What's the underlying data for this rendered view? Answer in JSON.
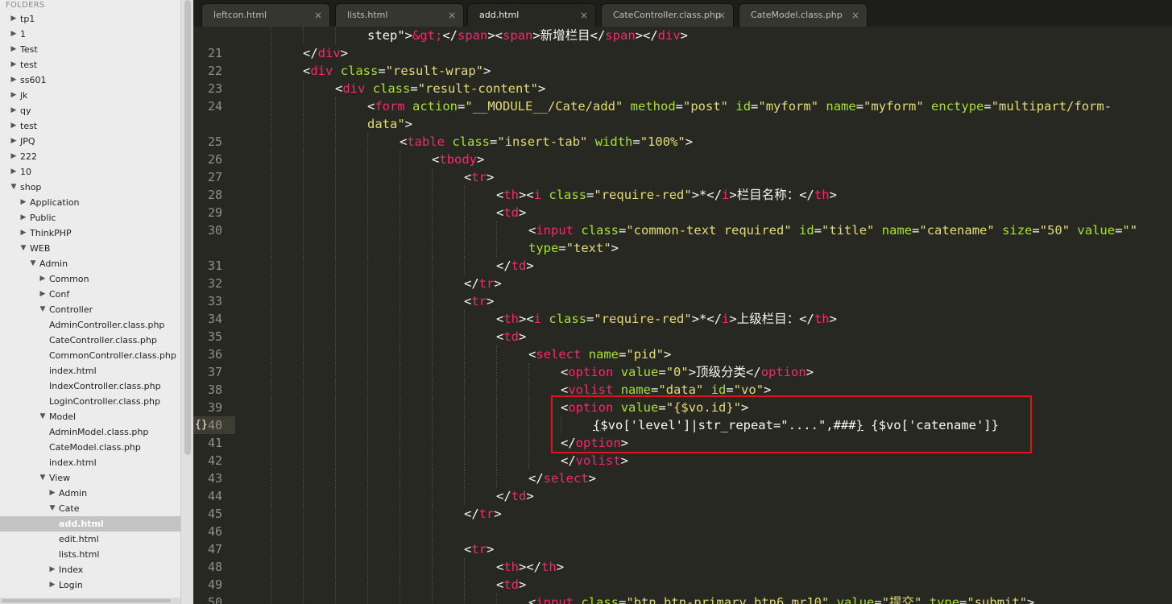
{
  "sidebar": {
    "header": "FOLDERS",
    "items": [
      {
        "label": "tp1",
        "depth": 0,
        "expanded": false
      },
      {
        "label": "1",
        "depth": 0,
        "expanded": false
      },
      {
        "label": "Test",
        "depth": 0,
        "expanded": false
      },
      {
        "label": "test",
        "depth": 0,
        "expanded": false
      },
      {
        "label": "ss601",
        "depth": 0,
        "expanded": false
      },
      {
        "label": "jk",
        "depth": 0,
        "expanded": false
      },
      {
        "label": "qy",
        "depth": 0,
        "expanded": false
      },
      {
        "label": "test",
        "depth": 0,
        "expanded": false
      },
      {
        "label": "JPQ",
        "depth": 0,
        "expanded": false
      },
      {
        "label": "222",
        "depth": 0,
        "expanded": false
      },
      {
        "label": "10",
        "depth": 0,
        "expanded": false
      },
      {
        "label": "shop",
        "depth": 0,
        "expanded": true
      },
      {
        "label": "Application",
        "depth": 1,
        "expanded": false
      },
      {
        "label": "Public",
        "depth": 1,
        "expanded": false
      },
      {
        "label": "ThinkPHP",
        "depth": 1,
        "expanded": false
      },
      {
        "label": "WEB",
        "depth": 1,
        "expanded": true
      },
      {
        "label": "Admin",
        "depth": 2,
        "expanded": true
      },
      {
        "label": "Common",
        "depth": 3,
        "expanded": false
      },
      {
        "label": "Conf",
        "depth": 3,
        "expanded": false
      },
      {
        "label": "Controller",
        "depth": 3,
        "expanded": true
      },
      {
        "label": "AdminController.class.php",
        "depth": 4,
        "file": true
      },
      {
        "label": "CateController.class.php",
        "depth": 4,
        "file": true
      },
      {
        "label": "CommonController.class.php",
        "depth": 4,
        "file": true
      },
      {
        "label": "index.html",
        "depth": 4,
        "file": true
      },
      {
        "label": "IndexController.class.php",
        "depth": 4,
        "file": true
      },
      {
        "label": "LoginController.class.php",
        "depth": 4,
        "file": true
      },
      {
        "label": "Model",
        "depth": 3,
        "expanded": true
      },
      {
        "label": "AdminModel.class.php",
        "depth": 4,
        "file": true
      },
      {
        "label": "CateModel.class.php",
        "depth": 4,
        "file": true
      },
      {
        "label": "index.html",
        "depth": 4,
        "file": true
      },
      {
        "label": "View",
        "depth": 3,
        "expanded": true
      },
      {
        "label": "Admin",
        "depth": 4,
        "expanded": false
      },
      {
        "label": "Cate",
        "depth": 4,
        "expanded": true
      },
      {
        "label": "add.html",
        "depth": 5,
        "file": true,
        "selected": true
      },
      {
        "label": "edit.html",
        "depth": 5,
        "file": true
      },
      {
        "label": "lists.html",
        "depth": 5,
        "file": true
      },
      {
        "label": "Index",
        "depth": 4,
        "expanded": false
      },
      {
        "label": "Login",
        "depth": 4,
        "expanded": false
      }
    ]
  },
  "tabs": [
    {
      "label": "leftcon.html",
      "active": false
    },
    {
      "label": "lists.html",
      "active": false
    },
    {
      "label": "add.html",
      "active": true
    },
    {
      "label": "CateController.class.php",
      "active": false
    },
    {
      "label": "CateModel.class.php",
      "active": false
    }
  ],
  "close_glyph": "×",
  "fold_glyph": "{}",
  "lines": [
    {
      "num": "",
      "indent": 4,
      "segs": [
        [
          "p",
          "step\">"
        ],
        [
          "t",
          "&gt;"
        ],
        [
          "p",
          "</"
        ],
        [
          "t",
          "span"
        ],
        [
          "p",
          "><"
        ],
        [
          "t",
          "span"
        ],
        [
          "p",
          ">新增栏目</"
        ],
        [
          "t",
          "span"
        ],
        [
          "p",
          "></"
        ],
        [
          "t",
          "div"
        ],
        [
          "p",
          ">"
        ]
      ]
    },
    {
      "num": "21",
      "indent": 2,
      "segs": [
        [
          "p",
          "</"
        ],
        [
          "t",
          "div"
        ],
        [
          "p",
          ">"
        ]
      ]
    },
    {
      "num": "22",
      "indent": 2,
      "segs": [
        [
          "p",
          "<"
        ],
        [
          "t",
          "div"
        ],
        [
          "p",
          " "
        ],
        [
          "a",
          "class"
        ],
        [
          "p",
          "="
        ],
        [
          "s",
          "\"result-wrap\""
        ],
        [
          "p",
          ">"
        ]
      ]
    },
    {
      "num": "23",
      "indent": 3,
      "segs": [
        [
          "p",
          "<"
        ],
        [
          "t",
          "div"
        ],
        [
          "p",
          " "
        ],
        [
          "a",
          "class"
        ],
        [
          "p",
          "="
        ],
        [
          "s",
          "\"result-content\""
        ],
        [
          "p",
          ">"
        ]
      ]
    },
    {
      "num": "24",
      "indent": 4,
      "segs": [
        [
          "p",
          "<"
        ],
        [
          "t",
          "form"
        ],
        [
          "p",
          " "
        ],
        [
          "a",
          "action"
        ],
        [
          "p",
          "="
        ],
        [
          "s",
          "\"__MODULE__/Cate/add\""
        ],
        [
          "p",
          " "
        ],
        [
          "a",
          "method"
        ],
        [
          "p",
          "="
        ],
        [
          "s",
          "\"post\""
        ],
        [
          "p",
          " "
        ],
        [
          "a",
          "id"
        ],
        [
          "p",
          "="
        ],
        [
          "s",
          "\"myform\""
        ],
        [
          "p",
          " "
        ],
        [
          "a",
          "name"
        ],
        [
          "p",
          "="
        ],
        [
          "s",
          "\"myform\""
        ],
        [
          "p",
          " "
        ],
        [
          "a",
          "enctype"
        ],
        [
          "p",
          "="
        ],
        [
          "s",
          "\"multipart/form-"
        ]
      ]
    },
    {
      "num": "",
      "indent": 4,
      "segs": [
        [
          "s",
          "data\""
        ],
        [
          "p",
          ">"
        ]
      ]
    },
    {
      "num": "25",
      "indent": 5,
      "segs": [
        [
          "p",
          "<"
        ],
        [
          "t",
          "table"
        ],
        [
          "p",
          " "
        ],
        [
          "a",
          "class"
        ],
        [
          "p",
          "="
        ],
        [
          "s",
          "\"insert-tab\""
        ],
        [
          "p",
          " "
        ],
        [
          "a",
          "width"
        ],
        [
          "p",
          "="
        ],
        [
          "s",
          "\"100%\""
        ],
        [
          "p",
          ">"
        ]
      ]
    },
    {
      "num": "26",
      "indent": 6,
      "segs": [
        [
          "p",
          "<"
        ],
        [
          "t",
          "tbody"
        ],
        [
          "p",
          ">"
        ]
      ]
    },
    {
      "num": "27",
      "indent": 7,
      "segs": [
        [
          "p",
          "<"
        ],
        [
          "t",
          "tr"
        ],
        [
          "p",
          ">"
        ]
      ]
    },
    {
      "num": "28",
      "indent": 8,
      "segs": [
        [
          "p",
          "<"
        ],
        [
          "t",
          "th"
        ],
        [
          "p",
          "><"
        ],
        [
          "t",
          "i"
        ],
        [
          "p",
          " "
        ],
        [
          "a",
          "class"
        ],
        [
          "p",
          "="
        ],
        [
          "s",
          "\"require-red\""
        ],
        [
          "p",
          ">*</"
        ],
        [
          "t",
          "i"
        ],
        [
          "p",
          ">栏目名称：</"
        ],
        [
          "t",
          "th"
        ],
        [
          "p",
          ">"
        ]
      ]
    },
    {
      "num": "29",
      "indent": 8,
      "segs": [
        [
          "p",
          "<"
        ],
        [
          "t",
          "td"
        ],
        [
          "p",
          ">"
        ]
      ]
    },
    {
      "num": "30",
      "indent": 9,
      "segs": [
        [
          "p",
          "<"
        ],
        [
          "t",
          "input"
        ],
        [
          "p",
          " "
        ],
        [
          "a",
          "class"
        ],
        [
          "p",
          "="
        ],
        [
          "s",
          "\"common-text required\""
        ],
        [
          "p",
          " "
        ],
        [
          "a",
          "id"
        ],
        [
          "p",
          "="
        ],
        [
          "s",
          "\"title\""
        ],
        [
          "p",
          " "
        ],
        [
          "a",
          "name"
        ],
        [
          "p",
          "="
        ],
        [
          "s",
          "\"catename\""
        ],
        [
          "p",
          " "
        ],
        [
          "a",
          "size"
        ],
        [
          "p",
          "="
        ],
        [
          "s",
          "\"50\""
        ],
        [
          "p",
          " "
        ],
        [
          "a",
          "value"
        ],
        [
          "p",
          "="
        ],
        [
          "s",
          "\"\""
        ]
      ]
    },
    {
      "num": "",
      "indent": 9,
      "segs": [
        [
          "a",
          "type"
        ],
        [
          "p",
          "="
        ],
        [
          "s",
          "\"text\""
        ],
        [
          "p",
          ">"
        ]
      ]
    },
    {
      "num": "31",
      "indent": 8,
      "segs": [
        [
          "p",
          "</"
        ],
        [
          "t",
          "td"
        ],
        [
          "p",
          ">"
        ]
      ]
    },
    {
      "num": "32",
      "indent": 7,
      "segs": [
        [
          "p",
          "</"
        ],
        [
          "t",
          "tr"
        ],
        [
          "p",
          ">"
        ]
      ]
    },
    {
      "num": "33",
      "indent": 7,
      "segs": [
        [
          "p",
          "<"
        ],
        [
          "t",
          "tr"
        ],
        [
          "p",
          ">"
        ]
      ]
    },
    {
      "num": "34",
      "indent": 8,
      "segs": [
        [
          "p",
          "<"
        ],
        [
          "t",
          "th"
        ],
        [
          "p",
          "><"
        ],
        [
          "t",
          "i"
        ],
        [
          "p",
          " "
        ],
        [
          "a",
          "class"
        ],
        [
          "p",
          "="
        ],
        [
          "s",
          "\"require-red\""
        ],
        [
          "p",
          ">*</"
        ],
        [
          "t",
          "i"
        ],
        [
          "p",
          ">上级栏目：</"
        ],
        [
          "t",
          "th"
        ],
        [
          "p",
          ">"
        ]
      ]
    },
    {
      "num": "35",
      "indent": 8,
      "segs": [
        [
          "p",
          "<"
        ],
        [
          "t",
          "td"
        ],
        [
          "p",
          ">"
        ]
      ]
    },
    {
      "num": "36",
      "indent": 9,
      "segs": [
        [
          "p",
          "<"
        ],
        [
          "t",
          "select"
        ],
        [
          "p",
          " "
        ],
        [
          "a",
          "name"
        ],
        [
          "p",
          "="
        ],
        [
          "s",
          "\"pid\""
        ],
        [
          "p",
          ">"
        ]
      ]
    },
    {
      "num": "37",
      "indent": 10,
      "segs": [
        [
          "p",
          "<"
        ],
        [
          "t",
          "option"
        ],
        [
          "p",
          " "
        ],
        [
          "a",
          "value"
        ],
        [
          "p",
          "="
        ],
        [
          "s",
          "\"0\""
        ],
        [
          "p",
          ">顶级分类</"
        ],
        [
          "t",
          "option"
        ],
        [
          "p",
          ">"
        ]
      ]
    },
    {
      "num": "38",
      "indent": 10,
      "segs": [
        [
          "p",
          "<"
        ],
        [
          "t",
          "volist"
        ],
        [
          "p",
          " "
        ],
        [
          "a",
          "name"
        ],
        [
          "p",
          "="
        ],
        [
          "s",
          "\"data\""
        ],
        [
          "p",
          " "
        ],
        [
          "a",
          "id"
        ],
        [
          "p",
          "="
        ],
        [
          "s",
          "\"vo\""
        ],
        [
          "p",
          ">"
        ]
      ]
    },
    {
      "num": "39",
      "indent": 10,
      "segs": [
        [
          "p",
          "<"
        ],
        [
          "t",
          "option"
        ],
        [
          "p",
          " "
        ],
        [
          "a",
          "value"
        ],
        [
          "p",
          "="
        ],
        [
          "s",
          "\"{$vo.id}\""
        ],
        [
          "p",
          ">"
        ]
      ]
    },
    {
      "num": "40",
      "indent": 11,
      "current": true,
      "segs": [
        [
          "u",
          "{"
        ],
        [
          "p",
          "$vo['level']|str_repeat=\"....\",###"
        ],
        [
          "u",
          "}"
        ],
        [
          "p",
          " {$vo['catename']}"
        ]
      ]
    },
    {
      "num": "41",
      "indent": 10,
      "segs": [
        [
          "p",
          "</"
        ],
        [
          "t",
          "option"
        ],
        [
          "p",
          ">"
        ]
      ]
    },
    {
      "num": "42",
      "indent": 10,
      "segs": [
        [
          "p",
          "</"
        ],
        [
          "t",
          "volist"
        ],
        [
          "p",
          ">"
        ]
      ]
    },
    {
      "num": "43",
      "indent": 9,
      "segs": [
        [
          "p",
          "</"
        ],
        [
          "t",
          "select"
        ],
        [
          "p",
          ">"
        ]
      ]
    },
    {
      "num": "44",
      "indent": 8,
      "segs": [
        [
          "p",
          "</"
        ],
        [
          "t",
          "td"
        ],
        [
          "p",
          ">"
        ]
      ]
    },
    {
      "num": "45",
      "indent": 7,
      "segs": [
        [
          "p",
          "</"
        ],
        [
          "t",
          "tr"
        ],
        [
          "p",
          ">"
        ]
      ]
    },
    {
      "num": "46",
      "indent": 7,
      "segs": []
    },
    {
      "num": "47",
      "indent": 7,
      "segs": [
        [
          "p",
          "<"
        ],
        [
          "t",
          "tr"
        ],
        [
          "p",
          ">"
        ]
      ]
    },
    {
      "num": "48",
      "indent": 8,
      "segs": [
        [
          "p",
          "<"
        ],
        [
          "t",
          "th"
        ],
        [
          "p",
          "></"
        ],
        [
          "t",
          "th"
        ],
        [
          "p",
          ">"
        ]
      ]
    },
    {
      "num": "49",
      "indent": 8,
      "segs": [
        [
          "p",
          "<"
        ],
        [
          "t",
          "td"
        ],
        [
          "p",
          ">"
        ]
      ]
    },
    {
      "num": "50",
      "indent": 9,
      "segs": [
        [
          "p",
          "<"
        ],
        [
          "t",
          "input"
        ],
        [
          "p",
          " "
        ],
        [
          "a",
          "class"
        ],
        [
          "p",
          "="
        ],
        [
          "s",
          "\"btn btn-primary btn6 mr10\""
        ],
        [
          "p",
          " "
        ],
        [
          "a",
          "value"
        ],
        [
          "p",
          "="
        ],
        [
          "s",
          "\"提交\""
        ],
        [
          "p",
          " "
        ],
        [
          "a",
          "type"
        ],
        [
          "p",
          "="
        ],
        [
          "s",
          "\"submit\""
        ],
        [
          "p",
          ">"
        ]
      ]
    }
  ],
  "colors": {
    "tag": "#f92672",
    "attr": "#a6e22e",
    "string": "#e6db74",
    "text": "#f8f8f2",
    "highlight_box": "#e0141b"
  }
}
